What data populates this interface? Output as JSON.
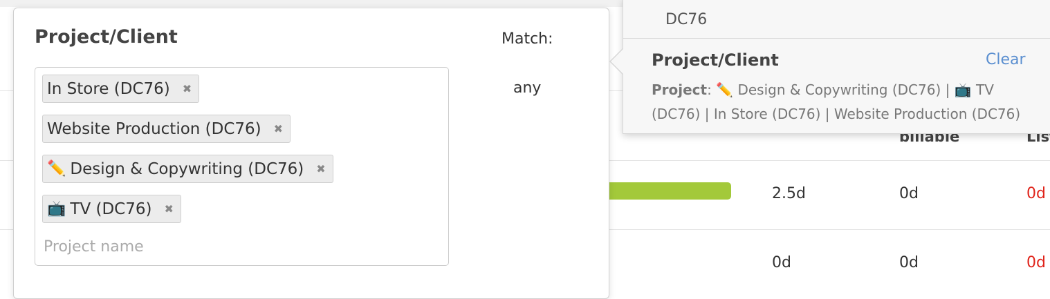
{
  "table": {
    "headers": {
      "billable": "billable",
      "list": "List"
    },
    "rows": [
      {
        "progress": 1.0,
        "col1": "2.5d",
        "col2": "0d",
        "col3": "0d"
      },
      {
        "col1": "0d",
        "col2": "0d",
        "col3": "0d"
      }
    ],
    "colors": {
      "progress": "#a3c93a",
      "over": "#e0241b"
    }
  },
  "filter_popover": {
    "title": "Project/Client",
    "match_label": "Match:",
    "match_value": "any",
    "tags": [
      {
        "emoji": "",
        "label": "In Store (DC76)"
      },
      {
        "emoji": "",
        "label": "Website Production (DC76)"
      },
      {
        "emoji": "✏️",
        "label": "Design & Copywriting (DC76)"
      },
      {
        "emoji": "📺",
        "label": "TV (DC76)"
      }
    ],
    "remove_glyph": "✖",
    "input_placeholder": "Project name"
  },
  "tooltip": {
    "workspace": "DC76",
    "title": "Project/Client",
    "clear_label": "Clear",
    "summary_label": "Project",
    "summary_text": "✏️ Design & Copywriting (DC76) | 📺 TV (DC76) | In Store (DC76) | Website Production (DC76)",
    "accent_color": "#5b8fd0"
  }
}
